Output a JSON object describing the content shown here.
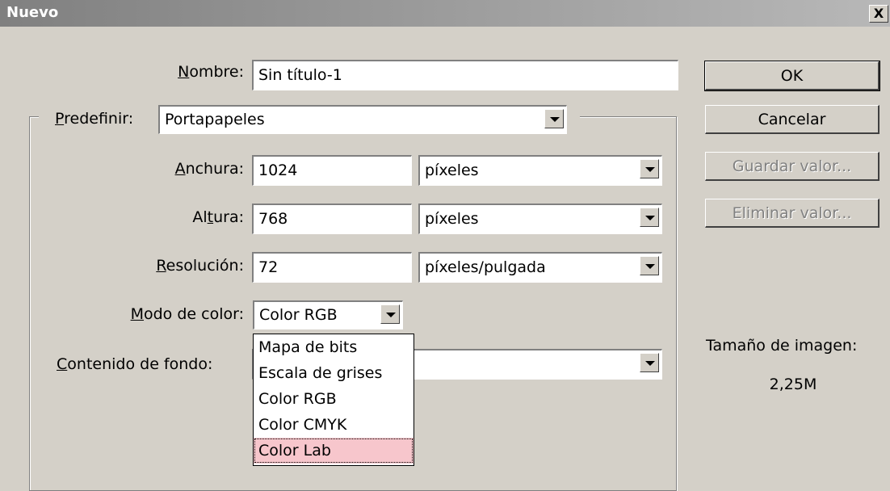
{
  "window": {
    "title": "Nuevo",
    "close_label": "X"
  },
  "form": {
    "nombre": {
      "label": "Nombre:",
      "value": "Sin título-1"
    },
    "predefinir": {
      "label": "Predefinir:",
      "value": "Portapapeles"
    },
    "anchura": {
      "label": "Anchura:",
      "value": "1024",
      "unit": "píxeles"
    },
    "altura": {
      "label": "Altura:",
      "value": "768",
      "unit": "píxeles"
    },
    "resolucion": {
      "label": "Resolución:",
      "value": "72",
      "unit": "píxeles/pulgada"
    },
    "modo": {
      "label": "Modo de color:",
      "value": "Color RGB"
    },
    "contenido": {
      "label": "Contenido de fondo:",
      "value": ""
    }
  },
  "buttons": {
    "ok": "OK",
    "cancelar": "Cancelar",
    "guardar": "Guardar valor...",
    "eliminar": "Eliminar valor..."
  },
  "info": {
    "label": "Tamaño de imagen:",
    "value": "2,25M"
  },
  "modo_options": [
    "Mapa de bits",
    "Escala de grises",
    "Color RGB",
    "Color CMYK",
    "Color Lab"
  ],
  "modo_highlighted": "Color Lab",
  "colors": {
    "highlight": "#f7c6cc",
    "face": "#d4d0c8"
  }
}
